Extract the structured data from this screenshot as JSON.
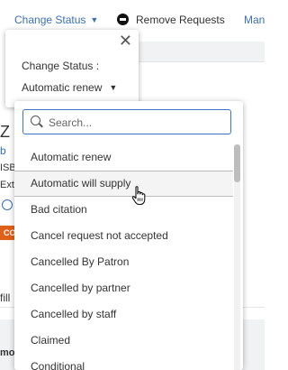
{
  "toolbar": {
    "change_status_label": "Change Status",
    "remove_requests_label": "Remove Requests",
    "more_label": "Man"
  },
  "background": {
    "partial_letters": [
      "Z",
      "b",
      "ISB",
      "Ext"
    ],
    "badge_text": "CO",
    "fill_text": "fill",
    "bottom_text": "mo"
  },
  "popover": {
    "title": "Change Status :",
    "selected_value": "Automatic renew"
  },
  "dropdown": {
    "search_placeholder": "Search...",
    "options": [
      "Automatic renew",
      "Automatic will supply",
      "Bad citation",
      "Cancel request not accepted",
      "Cancelled By Patron",
      "Cancelled by partner",
      "Cancelled by staff",
      "Claimed",
      "Conditional"
    ],
    "hovered_index": 1
  },
  "colors": {
    "link_blue": "#3a70b4",
    "badge_orange": "#e0601a",
    "search_border": "#3a76c4"
  }
}
